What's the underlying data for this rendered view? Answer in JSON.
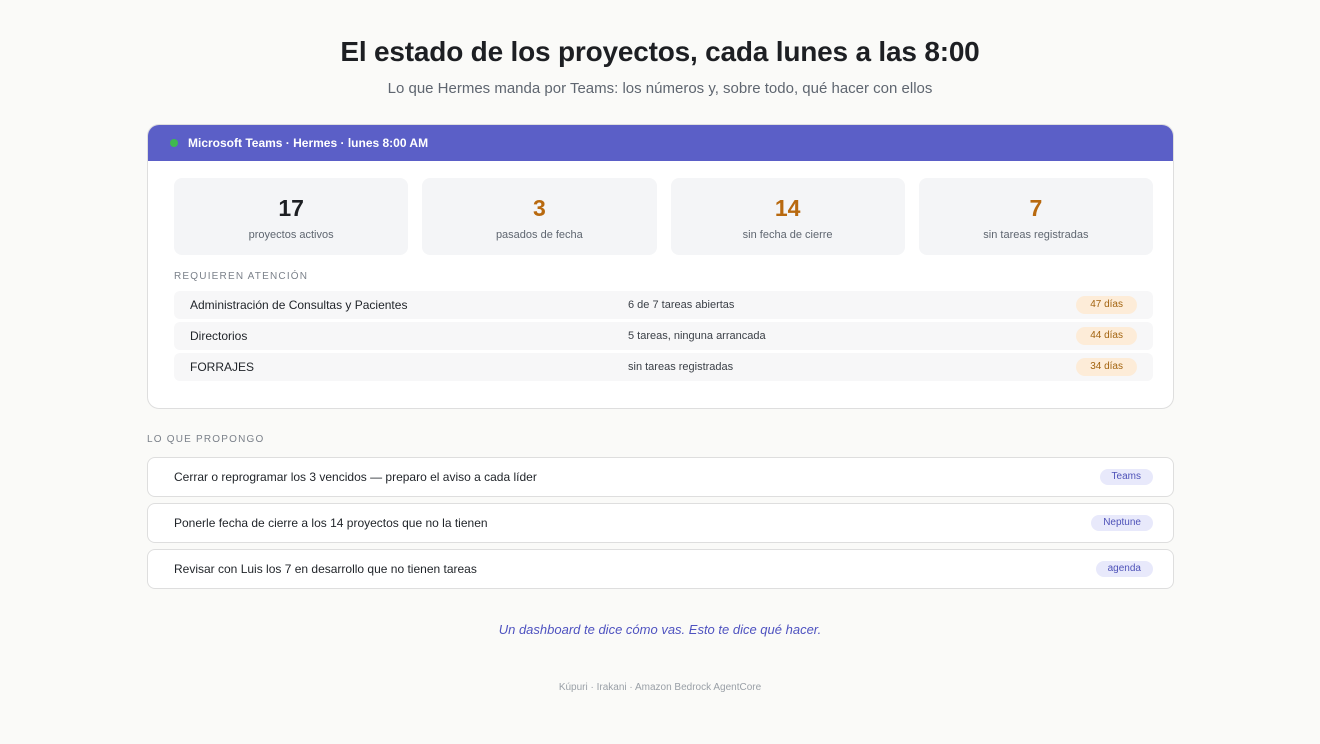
{
  "header": {
    "title": "El estado de los proyectos, cada lunes a las 8:00",
    "subtitle": "Lo que Hermes manda por Teams: los números y, sobre todo, qué hacer con ellos"
  },
  "teams_card": {
    "header_text": "Microsoft Teams · Hermes · lunes 8:00 AM",
    "status_color": "#3fb950",
    "header_color": "#5b5fc7",
    "stats": [
      {
        "value": "17",
        "label": "proyectos activos",
        "color": "#1d1f23"
      },
      {
        "value": "3",
        "label": "pasados de fecha",
        "color": "#b8690f"
      },
      {
        "value": "14",
        "label": "sin fecha de cierre",
        "color": "#b8690f"
      },
      {
        "value": "7",
        "label": "sin tareas registradas",
        "color": "#b8690f"
      }
    ],
    "attention_label": "REQUIEREN ATENCIÓN",
    "attention_rows": [
      {
        "name": "Administración de Consultas y Pacientes",
        "detail": "6 de 7 tareas abiertas",
        "days": "47 días"
      },
      {
        "name": "Directorios",
        "detail": "5 tareas, ninguna arrancada",
        "days": "44 días"
      },
      {
        "name": "FORRAJES",
        "detail": "sin tareas registradas",
        "days": "34 días"
      }
    ]
  },
  "proposals": {
    "label": "LO QUE PROPONGO",
    "items": [
      {
        "text": "Cerrar o reprogramar los 3 vencidos — preparo el aviso a cada líder",
        "tool": "Teams"
      },
      {
        "text": "Ponerle fecha de cierre a los 14 proyectos que no la tienen",
        "tool": "Neptune"
      },
      {
        "text": "Revisar con Luis los 7 en desarrollo que no tienen tareas",
        "tool": "agenda"
      }
    ]
  },
  "tagline": "Un dashboard te dice cómo vas. Esto te dice qué hacer.",
  "footer": "Kúpuri · Irakani · Amazon Bedrock AgentCore"
}
